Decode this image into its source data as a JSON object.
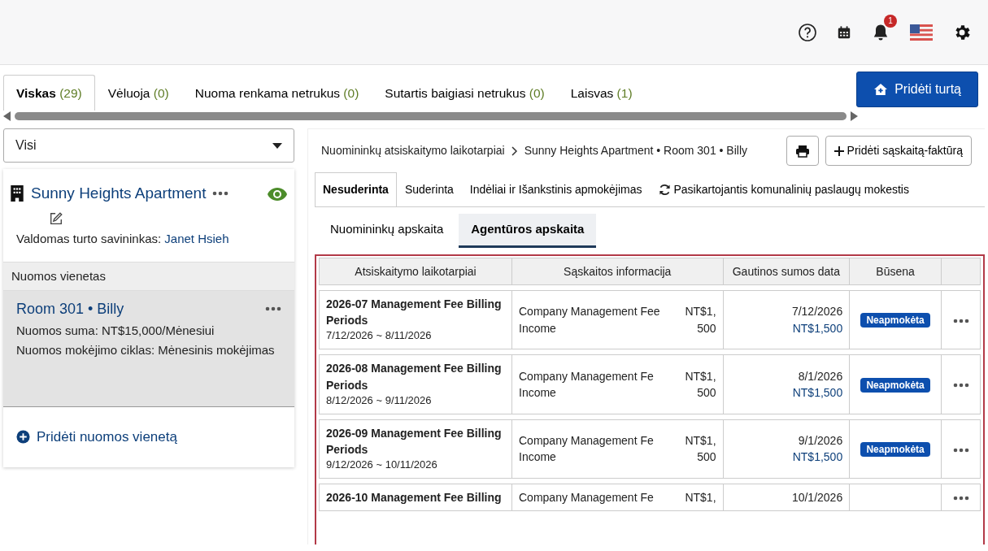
{
  "header": {
    "notification_count": "1"
  },
  "tabs": [
    {
      "label": "Viskas",
      "count": "(29)",
      "selected": true
    },
    {
      "label": "Vėluoja",
      "count": "(0)",
      "selected": false
    },
    {
      "label": "Nuoma renkama netrukus",
      "count": "(0)",
      "selected": false
    },
    {
      "label": "Sutartis baigiasi netrukus",
      "count": "(0)",
      "selected": false
    },
    {
      "label": "Laisvas",
      "count": "(1)",
      "selected": false
    }
  ],
  "add_property_button": "Pridėti turtą",
  "filter": {
    "value": "Visi"
  },
  "property": {
    "name": "Sunny Heights Apartment",
    "visible": true,
    "owner_label": "Valdomas turto savininkas:",
    "owner": "Janet Hsieh"
  },
  "units_section": {
    "title": "Nuomos vienetas",
    "units": [
      {
        "title": "Room 301 • Billy",
        "selected": true,
        "details": [
          "Nuomos suma: NT$15,000/Mėnesiui",
          "Nuomos mokėjimo ciklas: Mėnesinis mokėjimas"
        ]
      }
    ],
    "add_link": "Pridėti nuomos vienetą"
  },
  "breadcrumb": {
    "parent": "Nuomininkų atsiskaitymo laikotarpiai",
    "current": "Sunny Heights Apartment • Room 301 • Billy"
  },
  "add_invoice_button": "Pridėti sąskaitą-faktūrą",
  "detail_tabs": [
    {
      "label": "Nesuderinta",
      "selected": true,
      "kind": "plain"
    },
    {
      "label": "Suderinta",
      "selected": false,
      "kind": "plain"
    },
    {
      "label": "Indėliai ir Išankstinis apmokėjimas",
      "selected": false,
      "kind": "plain"
    },
    {
      "label": "Pasikartojantis komunalinių paslaugų mokestis",
      "selected": false,
      "kind": "recurring"
    }
  ],
  "sub_tabs": [
    {
      "label": "Nuomininkų apskaita",
      "selected": false
    },
    {
      "label": "Agentūros apskaita",
      "selected": true
    }
  ],
  "table": {
    "columns": [
      "Atsiskaitymo laikotarpiai",
      "Sąskaitos informacija",
      "Gautinos sumos data",
      "Būsena"
    ],
    "rows": [
      {
        "period": "2026-07 Management Fee Billing Periods",
        "range": "7/12/2026 ~ 8/11/2026",
        "info_lines": [
          "Company Management Fee",
          "Income"
        ],
        "amount": "NT$1,500",
        "due_date": "7/12/2026",
        "due_amount": "NT$1,500",
        "status": "Neapmokėta"
      },
      {
        "period": "2026-08 Management Fee Billing Periods",
        "range": "8/12/2026 ~ 9/11/2026",
        "info_lines": [
          "Company Management Fe",
          "Income"
        ],
        "amount": "NT$1,500",
        "due_date": "8/1/2026",
        "due_amount": "NT$1,500",
        "status": "Neapmokėta"
      },
      {
        "period": "2026-09 Management Fee Billing Periods",
        "range": "9/12/2026 ~ 10/11/2026",
        "info_lines": [
          "Company Management Fe",
          "Income"
        ],
        "amount": "NT$1,500",
        "due_date": "9/1/2026",
        "due_amount": "NT$1,500",
        "status": "Neapmokėta"
      },
      {
        "period": "2026-10 Management Fee Billing",
        "info_lines": [
          "Company Management Fe"
        ],
        "amount": "NT$1,",
        "due_date": "10/1/2026"
      }
    ]
  }
}
